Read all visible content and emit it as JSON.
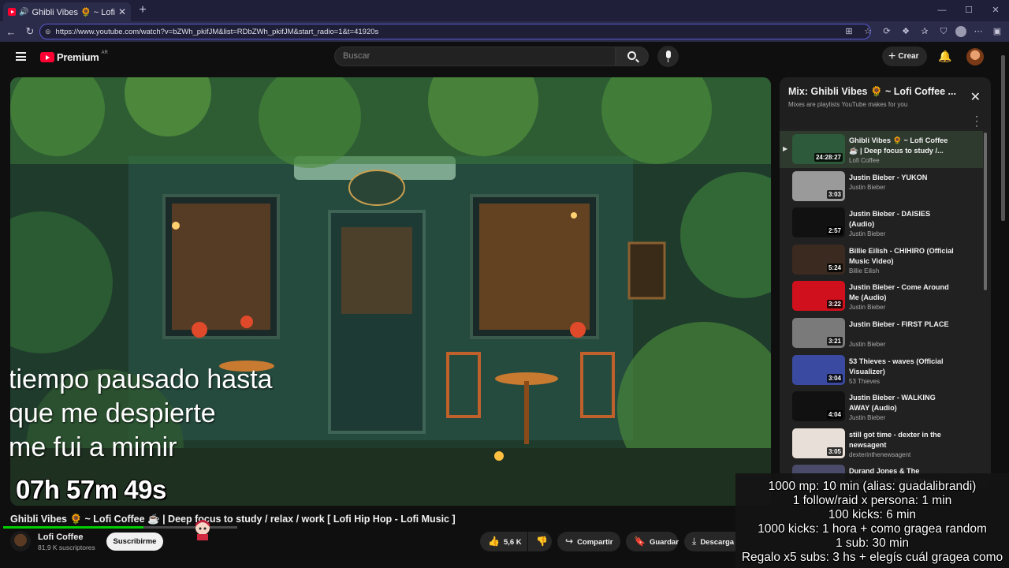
{
  "browser": {
    "tab_title": "Ghibli Vibes 🌻 ~ Lofi Coffee",
    "url": "https://www.youtube.com/watch?v=bZWh_pkifJM&list=RDbZWh_pkifJM&start_radio=1&t=41920s"
  },
  "header": {
    "logo": "Premium",
    "country": "AR",
    "search_placeholder": "Buscar",
    "create_label": "Crear"
  },
  "video": {
    "lyrics": [
      "tiempo pausado hasta",
      "que me despierte",
      "me fui a mimir"
    ],
    "timer": "07h 57m 49s",
    "progress": 0.6
  },
  "meta": {
    "title": "Ghibli Vibes 🌻 ~ Lofi Coffee ☕ | Deep focus to study / relax / work [ Lofi Hip Hop - Lofi Music ]",
    "channel": "Lofi Coffee",
    "subscribers": "81,9 K suscriptores",
    "subscribe_label": "Suscribirme",
    "likes": "5,6 K",
    "share_label": "Compartir",
    "save_label": "Guardar",
    "download_label": "Descarga"
  },
  "playlist": {
    "title": "Mix: Ghibli Vibes 🌻 ~ Lofi Coffee ...",
    "subtitle": "Mixes are playlists YouTube makes for you",
    "items": [
      {
        "title": "Ghibli Vibes 🌻 ~ Lofi Coffee ☕ | Deep focus to study /...",
        "channel": "Lofi Coffee",
        "duration": "24:28:27",
        "color": "#2d5a3a"
      },
      {
        "title": "Justin Bieber - YUKON",
        "channel": "Justin Bieber",
        "duration": "3:03",
        "color": "#9a9a9a"
      },
      {
        "title": "Justin Bieber - DAISIES (Audio)",
        "channel": "Justin Bieber",
        "duration": "2:57",
        "color": "#111111"
      },
      {
        "title": "Billie Eilish - CHIHIRO (Official Music Video)",
        "channel": "Billie Eilish",
        "duration": "5:24",
        "color": "#3a2a20"
      },
      {
        "title": "Justin Bieber - Come Around Me (Audio)",
        "channel": "Justin Bieber",
        "duration": "3:22",
        "color": "#d0101c"
      },
      {
        "title": "Justin Bieber - FIRST PLACE",
        "channel": "Justin Bieber",
        "duration": "3:21",
        "color": "#7a7a7a"
      },
      {
        "title": "53 Thieves - waves (Official Visualizer)",
        "channel": "53 Thieves",
        "duration": "3:04",
        "color": "#3a4aa0"
      },
      {
        "title": "Justin Bieber - WALKING AWAY (Audio)",
        "channel": "Justin Bieber",
        "duration": "4:04",
        "color": "#111111"
      },
      {
        "title": "still got time - dexter in the newsagent",
        "channel": "dexterinthenewsagent",
        "duration": "3:05",
        "color": "#e8e0d8"
      },
      {
        "title": "Durand Jones & The Indications - Flower Moon...",
        "channel": "",
        "duration": "",
        "color": "#4a4a6a"
      }
    ]
  },
  "overlay": {
    "lines": [
      "1000 mp: 10 min (alias: guadalibrandi)",
      "1 follow/raid x persona: 1 min",
      "100 kicks: 6 min",
      "1000 kicks: 1 hora + como gragea random",
      "1 sub: 30 min",
      "Regalo x5 subs: 3 hs + elegís cuál gragea como"
    ]
  }
}
